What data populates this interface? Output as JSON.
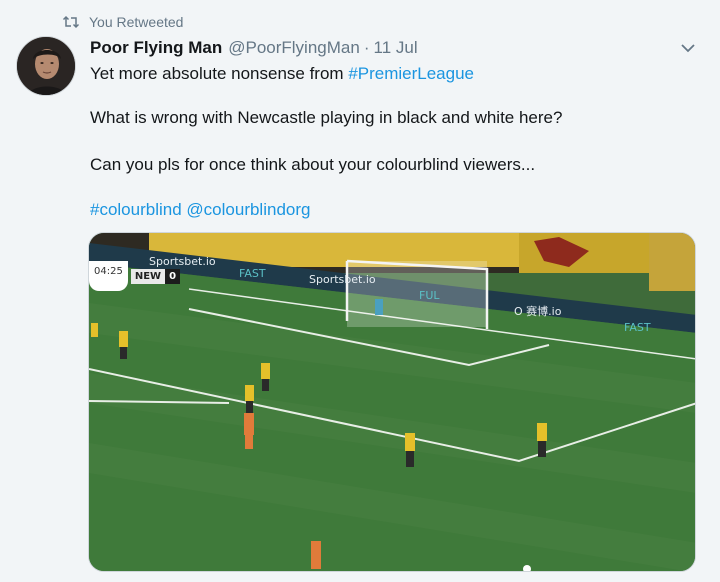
{
  "retweet": {
    "label": "You Retweeted",
    "icon": "retweet-icon"
  },
  "author": {
    "display_name": "Poor Flying Man",
    "handle": "@PoorFlyingMan",
    "separator": "·",
    "date": "11 Jul"
  },
  "tweet": {
    "line1_text": "Yet more absolute nonsense from ",
    "line1_hashtag": "#PremierLeague",
    "line2_text": "What is wrong with Newcastle playing in black and white here?",
    "line3_text": "Can you pls for once think about your colourblind viewers...",
    "line4_hashtag": "#colourblind",
    "line4_mention": "@colourblindorg"
  },
  "media": {
    "scoreboard": {
      "time": "04:25",
      "team": "NEW",
      "goals": "0"
    },
    "ad_boards": [
      "Sportsbet.io",
      "FAST",
      "Sportsbet.io",
      "FUL",
      "O 赛博.io",
      "FAST"
    ]
  },
  "colors": {
    "link": "#1b95e0",
    "muted": "#657786",
    "pitch": "#3f7a3a"
  }
}
